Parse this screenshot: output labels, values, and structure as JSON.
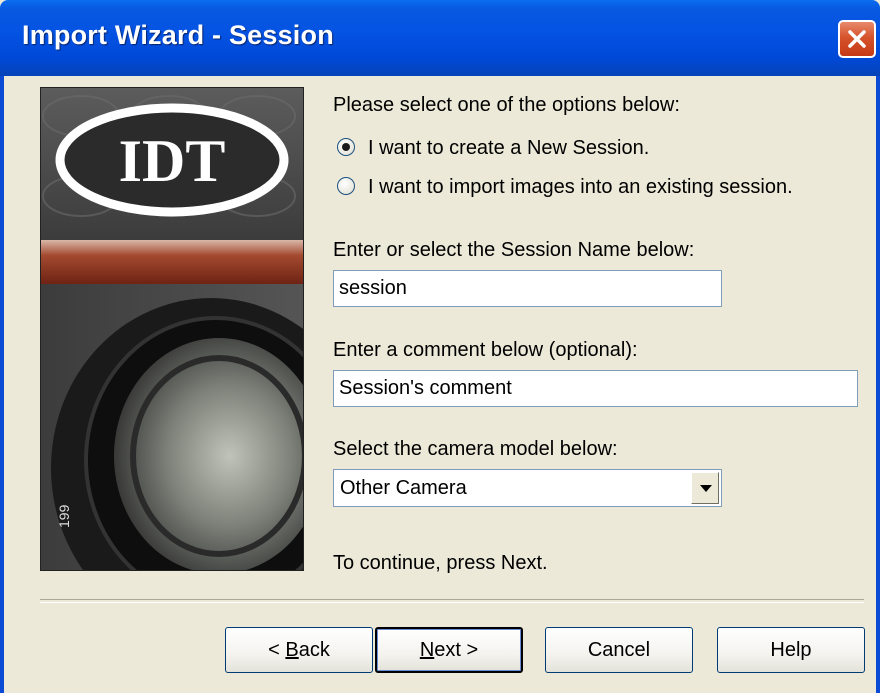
{
  "window": {
    "title": "Import Wizard - Session",
    "close_icon": "close-icon"
  },
  "banner": {
    "logo_text": "IDT",
    "lens_numbers": "199"
  },
  "options": {
    "prompt": "Please select one of the options below:",
    "radio_new": "I want to create a New Session.",
    "radio_existing": "I want to import images into an existing session.",
    "selected": "new"
  },
  "session": {
    "label": "Enter or select the Session Name below:",
    "value": "session"
  },
  "comment": {
    "label": "Enter a comment below (optional):",
    "value": "Session's comment"
  },
  "camera": {
    "label": "Select the camera model below:",
    "value": "Other Camera"
  },
  "hint": "To continue, press Next.",
  "buttons": {
    "back": {
      "prefix": "< ",
      "mnemonic": "B",
      "rest": "ack"
    },
    "next": {
      "mnemonic": "N",
      "rest": "ext >"
    },
    "cancel": "Cancel",
    "help": "Help"
  },
  "colors": {
    "titlebar": "#0054e3",
    "close": "#d6532b",
    "dialog_bg": "#ece9d8",
    "accent_stripe": "#8a2f1c"
  }
}
